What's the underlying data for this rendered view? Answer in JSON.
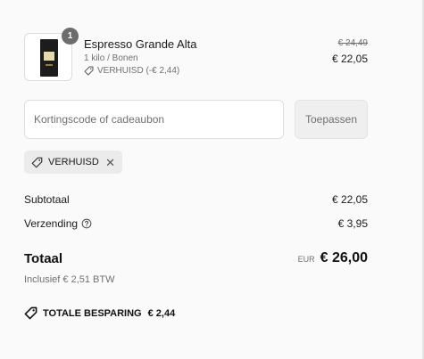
{
  "product": {
    "quantity": "1",
    "name": "Espresso Grande Alta",
    "variant": "1 kilo / Bonen",
    "discount_label": "VERHUISD (-€ 2,44)",
    "original_price": "€ 24,49",
    "price": "€ 22,05"
  },
  "discount_form": {
    "placeholder": "Kortingscode of cadeaubon",
    "value": "",
    "apply_label": "Toepassen"
  },
  "applied_code": {
    "label": "VERHUISD",
    "remove_icon": "close-icon"
  },
  "summary": {
    "subtotal_label": "Subtotaal",
    "subtotal_value": "€ 22,05",
    "shipping_label": "Verzending",
    "shipping_value": "€ 3,95",
    "total_label": "Totaal",
    "currency": "EUR",
    "total_value": "€ 26,00",
    "tax_note": "Inclusief € 2,51 BTW",
    "savings_label": "TOTALE BESPARING",
    "savings_value": "€ 2,44"
  },
  "icons": {
    "tag": "tag-icon",
    "help": "help-circle-icon"
  },
  "colors": {
    "background": "#fafafa",
    "text": "#1a1a1a",
    "muted": "#707070",
    "chip_bg": "#ebebeb",
    "button_bg": "#efefef",
    "badge_bg": "#6d6d6d"
  }
}
